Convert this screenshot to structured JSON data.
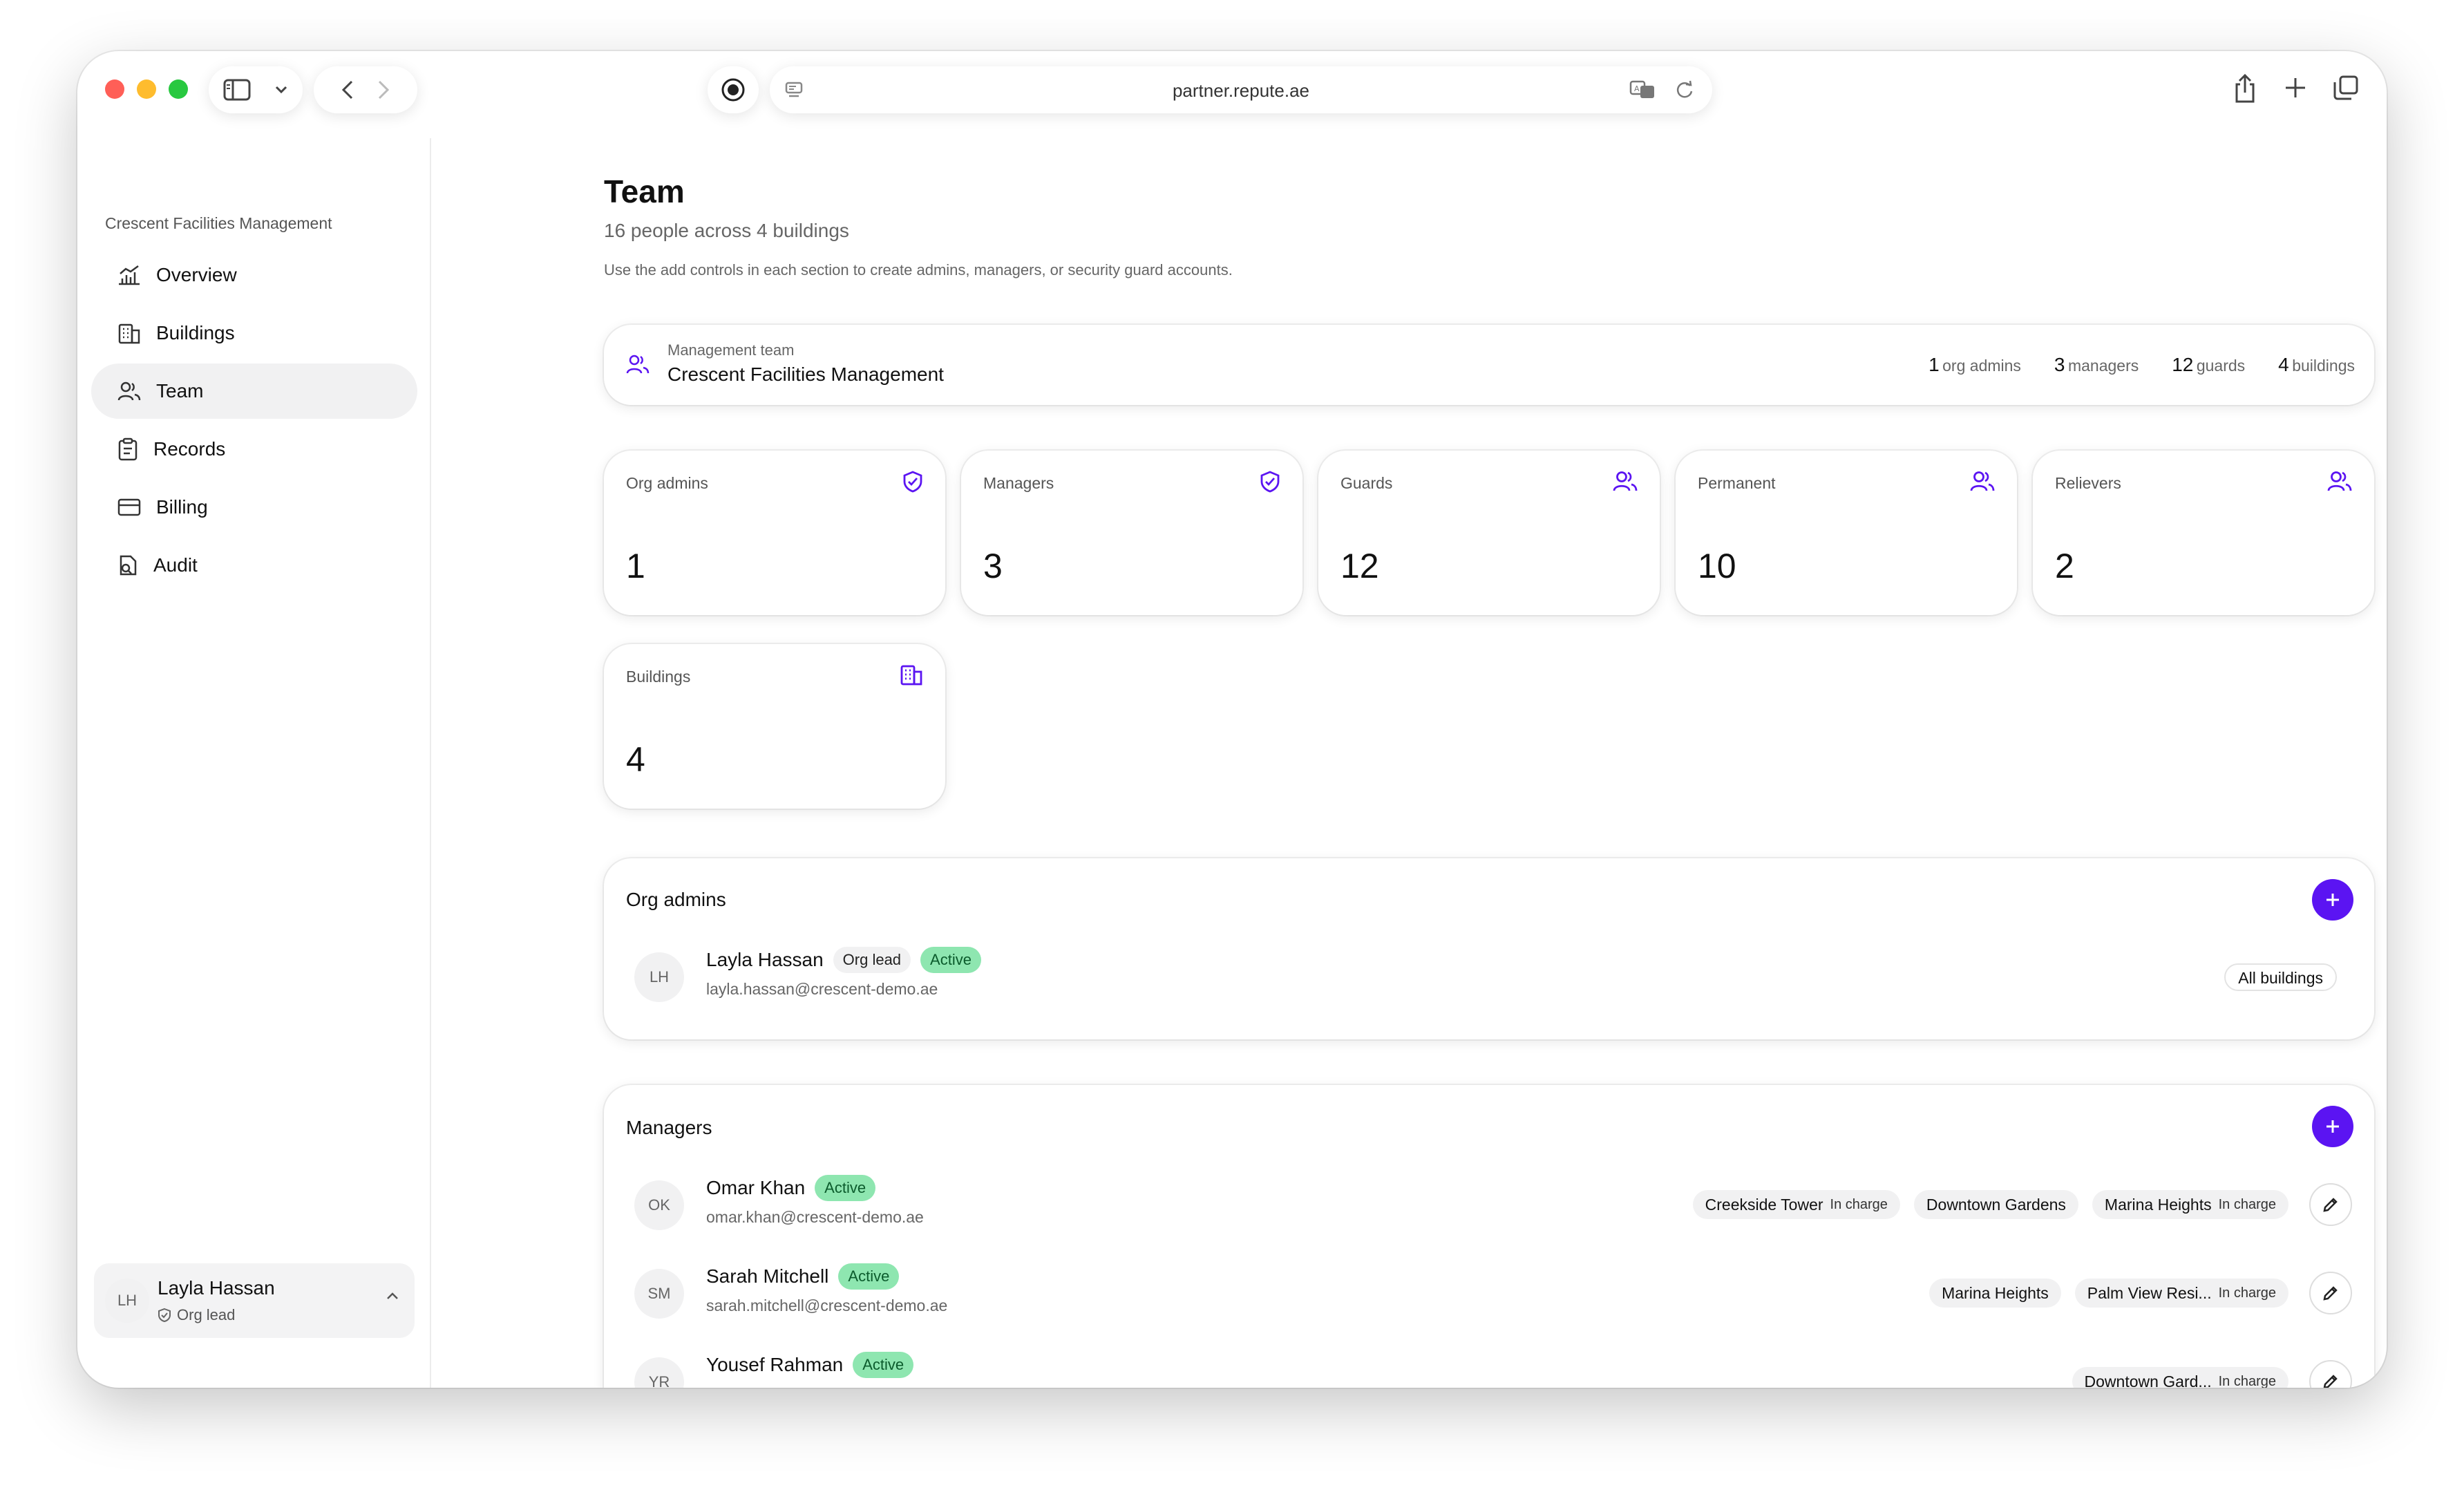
{
  "browser": {
    "url": "partner.repute.ae"
  },
  "sidebar": {
    "org_name": "Crescent Facilities Management",
    "items": [
      {
        "label": "Overview",
        "icon": "chart-icon"
      },
      {
        "label": "Buildings",
        "icon": "building-icon"
      },
      {
        "label": "Team",
        "icon": "users-icon",
        "active": true
      },
      {
        "label": "Records",
        "icon": "clipboard-icon"
      },
      {
        "label": "Billing",
        "icon": "credit-card-icon"
      },
      {
        "label": "Audit",
        "icon": "file-search-icon"
      }
    ],
    "user": {
      "initials": "LH",
      "name": "Layla Hassan",
      "role": "Org lead"
    }
  },
  "page": {
    "title": "Team",
    "subtitle": "16 people across 4 buildings",
    "hint": "Use the add controls in each section to create admins, managers, or security guard accounts."
  },
  "mgmt": {
    "label": "Management team",
    "name": "Crescent Facilities Management",
    "stats": [
      {
        "value": "1",
        "label": "org admins"
      },
      {
        "value": "3",
        "label": "managers"
      },
      {
        "value": "12",
        "label": "guards"
      },
      {
        "value": "4",
        "label": "buildings"
      }
    ]
  },
  "stat_cards": [
    {
      "label": "Org admins",
      "value": "1",
      "icon": "shield-check-icon"
    },
    {
      "label": "Managers",
      "value": "3",
      "icon": "shield-check-icon"
    },
    {
      "label": "Guards",
      "value": "12",
      "icon": "users-icon"
    },
    {
      "label": "Permanent",
      "value": "10",
      "icon": "users-icon"
    },
    {
      "label": "Relievers",
      "value": "2",
      "icon": "users-icon"
    },
    {
      "label": "Buildings",
      "value": "4",
      "icon": "building-icon"
    }
  ],
  "org_admins": {
    "title": "Org admins",
    "members": [
      {
        "initials": "LH",
        "name": "Layla Hassan",
        "role_badge": "Org lead",
        "status": "Active",
        "email": "layla.hassan@crescent-demo.ae",
        "scope": "All buildings"
      }
    ]
  },
  "managers": {
    "title": "Managers",
    "members": [
      {
        "initials": "OK",
        "name": "Omar Khan",
        "status": "Active",
        "email": "omar.khan@crescent-demo.ae",
        "buildings": [
          {
            "name": "Creekside Tower",
            "tag": "In charge"
          },
          {
            "name": "Downtown Gardens",
            "tag": ""
          },
          {
            "name": "Marina Heights",
            "tag": "In charge"
          }
        ]
      },
      {
        "initials": "SM",
        "name": "Sarah Mitchell",
        "status": "Active",
        "email": "sarah.mitchell@crescent-demo.ae",
        "buildings": [
          {
            "name": "Marina Heights",
            "tag": ""
          },
          {
            "name": "Palm View Resi...",
            "tag": "In charge"
          }
        ]
      },
      {
        "initials": "YR",
        "name": "Yousef Rahman",
        "status": "Active",
        "email": "",
        "buildings": [
          {
            "name": "Downtown Gard...",
            "tag": "In charge"
          }
        ]
      }
    ]
  },
  "colors": {
    "accent": "#5b14f2",
    "active_badge": "#8ee6b0"
  }
}
